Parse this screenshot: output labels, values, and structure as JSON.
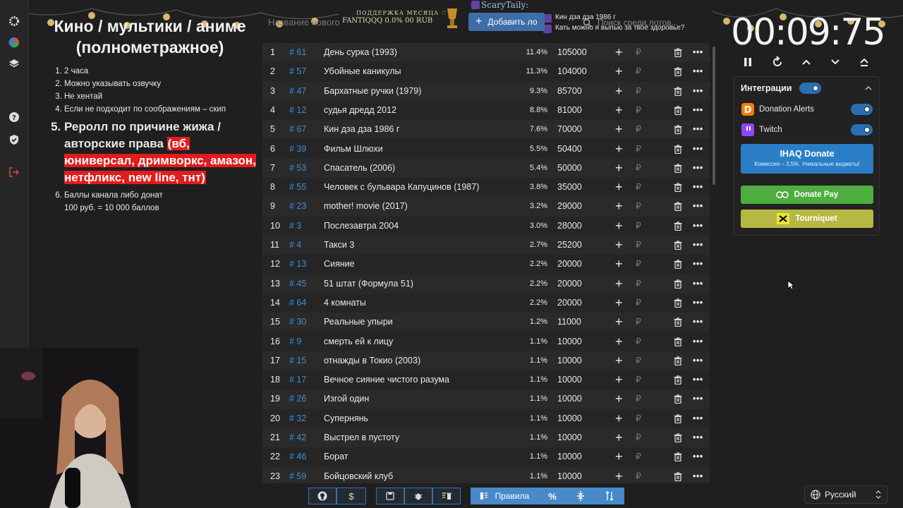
{
  "rules": {
    "title": "Кино / мультики / аниме (полнометражное)",
    "items": [
      "2 часа",
      "Можно указывать озвучку",
      "Не хентай",
      "Если не подходит по соображениям – скип"
    ],
    "item5_text": "Реролл по причине жижа / авторские права ",
    "item5_highlight": "(вб, юниверсал, дримворкс, амазон, нетфликс, new line, тнт)",
    "item6_line1": "Баллы канала либо донат",
    "item6_line2": "100 руб. = 10 000 баллов"
  },
  "top": {
    "name_placeholder": "Название нового",
    "support_title": "ПОДДЕРЖКА МЕСЯЦА ♡",
    "support_sub": "FANTIQQQ 0.0%  00 RUB",
    "add_button": "Добавить ло",
    "search_placeholder": "Поиск среди лотов...",
    "chat_user": "ScaryTaily:",
    "chat_line1": "Кин дза дза 1986 г",
    "chat_line2": "Кать можно я выпью за твоё здоровье?"
  },
  "timer": {
    "value": "00:09:75"
  },
  "integrations": {
    "title": "Интеграции",
    "donation_alerts": "Donation Alerts",
    "twitch": "Twitch",
    "ihaq_title": "IHAQ Donate",
    "ihaq_sub": "Комиссия – 3,5%. Уникальные виджеты!",
    "donatepay": "Donate Pay",
    "tourniquet": "Tourniquet"
  },
  "lots": [
    {
      "n": "1",
      "id": "# 61",
      "name": "День сурка (1993)",
      "pct": "11.4%",
      "sum": "105000"
    },
    {
      "n": "2",
      "id": "# 57",
      "name": "Убойные каникулы",
      "pct": "11.3%",
      "sum": "104000"
    },
    {
      "n": "3",
      "id": "# 47",
      "name": "Бархатные ручки (1979)",
      "pct": "9.3%",
      "sum": "85700"
    },
    {
      "n": "4",
      "id": "# 12",
      "name": "судья дредд 2012",
      "pct": "8.8%",
      "sum": "81000"
    },
    {
      "n": "5",
      "id": "# 67",
      "name": "Кин дза дза 1986 г",
      "pct": "7.6%",
      "sum": "70000"
    },
    {
      "n": "6",
      "id": "# 39",
      "name": "Фильм Шлюхи",
      "pct": "5.5%",
      "sum": "50400"
    },
    {
      "n": "7",
      "id": "# 53",
      "name": "Спасатель (2006)",
      "pct": "5.4%",
      "sum": "50000"
    },
    {
      "n": "8",
      "id": "# 55",
      "name": "Человек с бульвара Капуцинов (1987)",
      "pct": "3.8%",
      "sum": "35000"
    },
    {
      "n": "9",
      "id": "# 23",
      "name": "mother! movie (2017)",
      "pct": "3.2%",
      "sum": "29000"
    },
    {
      "n": "10",
      "id": "# 3",
      "name": "Послезавтра 2004",
      "pct": "3.0%",
      "sum": "28000"
    },
    {
      "n": "11",
      "id": "# 4",
      "name": "Такси 3",
      "pct": "2.7%",
      "sum": "25200"
    },
    {
      "n": "12",
      "id": "# 13",
      "name": "Сияние",
      "pct": "2.2%",
      "sum": "20000"
    },
    {
      "n": "13",
      "id": "# 45",
      "name": "51 штат (Формула 51)",
      "pct": "2.2%",
      "sum": "20000"
    },
    {
      "n": "14",
      "id": "# 64",
      "name": "4 комнаты",
      "pct": "2.2%",
      "sum": "20000"
    },
    {
      "n": "15",
      "id": "# 30",
      "name": "Реальные упыри",
      "pct": "1.2%",
      "sum": "11000"
    },
    {
      "n": "16",
      "id": "# 9",
      "name": "смерть ей к лицу",
      "pct": "1.1%",
      "sum": "10000"
    },
    {
      "n": "17",
      "id": "# 15",
      "name": "отнажды в Токио (2003)",
      "pct": "1.1%",
      "sum": "10000"
    },
    {
      "n": "18",
      "id": "# 17",
      "name": "Вечное сияние чистого разума",
      "pct": "1.1%",
      "sum": "10000"
    },
    {
      "n": "19",
      "id": "# 26",
      "name": "Изгой один",
      "pct": "1.1%",
      "sum": "10000"
    },
    {
      "n": "20",
      "id": "# 32",
      "name": " Супернянь",
      "pct": "1.1%",
      "sum": "10000"
    },
    {
      "n": "21",
      "id": "# 42",
      "name": "Выстрел в пустоту",
      "pct": "1.1%",
      "sum": "10000"
    },
    {
      "n": "22",
      "id": "# 46",
      "name": "Борат",
      "pct": "1.1%",
      "sum": "10000"
    },
    {
      "n": "23",
      "id": "# 59",
      "name": "Бойцовский клуб",
      "pct": "1.1%",
      "sum": "10000"
    }
  ],
  "row_actions": {
    "plus": "+",
    "rub": "₽",
    "more": "•••"
  },
  "toolbar": {
    "github_icon": "github-icon",
    "dollar": "$",
    "rules_button": "Правила",
    "percent": "%"
  },
  "language": {
    "value": "Русский"
  },
  "colors": {
    "accent": "#3a8fd8",
    "highlight_red": "#e21b1b",
    "donatepay_green": "#4dad3f",
    "ihaq_blue": "#2a7ec6",
    "tourniquet_yellow": "#b7b842"
  }
}
